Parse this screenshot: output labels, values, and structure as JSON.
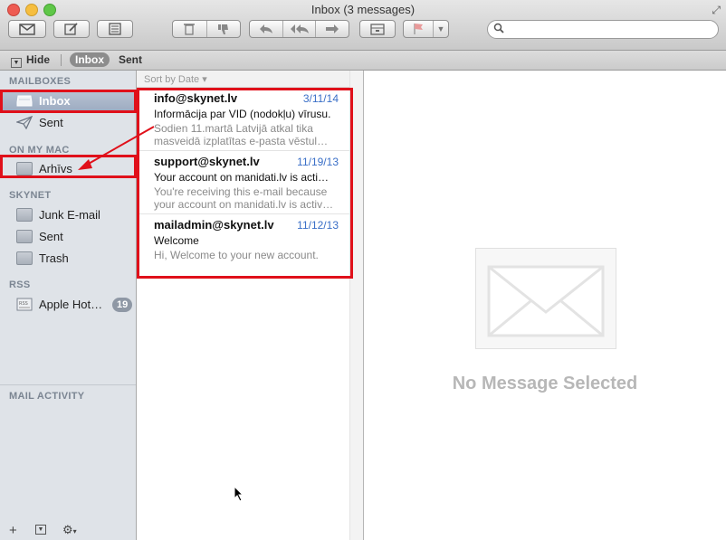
{
  "window": {
    "title": "Inbox (3 messages)"
  },
  "toolbar": {
    "buttons": [
      "get-mail",
      "compose",
      "note",
      "delete",
      "junk",
      "reply",
      "reply-all",
      "forward",
      "archive",
      "flag"
    ]
  },
  "search": {
    "placeholder": "",
    "value": ""
  },
  "favorites_bar": {
    "hide_label": "Hide",
    "inbox_label": "Inbox",
    "sent_label": "Sent"
  },
  "sidebar": {
    "mailboxes_header": "MAILBOXES",
    "inbox_label": "Inbox",
    "sent_label": "Sent",
    "onmymac_header": "ON MY MAC",
    "arhivs_label": "Arhīvs",
    "skynet_header": "SKYNET",
    "junk_label": "Junk E-mail",
    "skynet_sent_label": "Sent",
    "trash_label": "Trash",
    "rss_header": "RSS",
    "rss_label": "Apple Hot…",
    "rss_badge": "19",
    "activity_header": "MAIL ACTIVITY"
  },
  "message_list": {
    "sort_label": "Sort by Date ▾",
    "messages": [
      {
        "from": "info@skynet.lv",
        "date": "3/11/14",
        "subject": "Informācija par VID (nodokļu)  vīrusu.",
        "preview_1": "Sodien 11.martā Latvijā atkal tika",
        "preview_2": "masveidā izplatītas e-pasta vēstul…"
      },
      {
        "from": "support@skynet.lv",
        "date": "11/19/13",
        "subject": "Your account on manidati.lv is acti…",
        "preview_1": "You're receiving this e-mail because",
        "preview_2": "your account on manidati.lv is activ…"
      },
      {
        "from": "mailadmin@skynet.lv",
        "date": "11/12/13",
        "subject": "Welcome",
        "preview_1": "Hi, Welcome to your new account.",
        "preview_2": ""
      }
    ]
  },
  "preview": {
    "empty_text": "No Message Selected"
  },
  "colors": {
    "highlight_red": "#e0101a",
    "date_blue": "#3a6fc7",
    "selection": "#9dabc1"
  }
}
